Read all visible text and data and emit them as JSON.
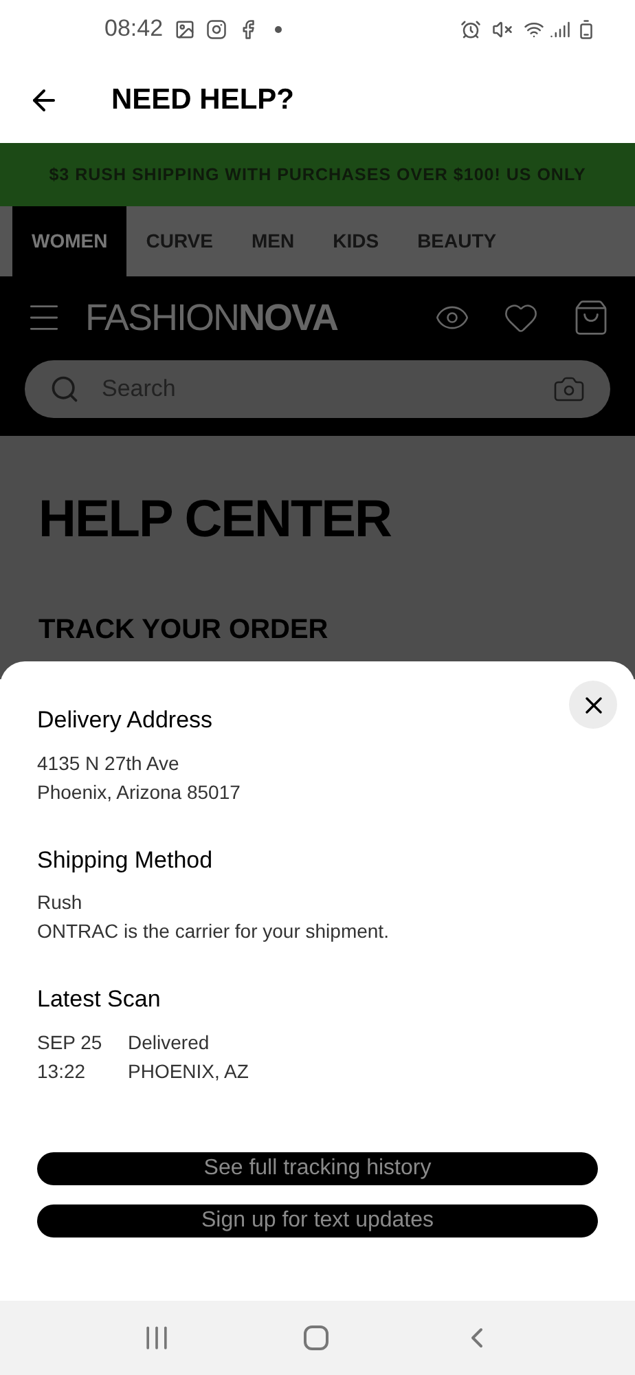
{
  "status_bar": {
    "time": "08:42"
  },
  "header": {
    "title": "NEED HELP?"
  },
  "banner": {
    "text": "$3 RUSH SHIPPING WITH PURCHASES OVER $100! US ONLY"
  },
  "tabs": [
    {
      "label": "WOMEN",
      "selected": true
    },
    {
      "label": "CURVE",
      "selected": false
    },
    {
      "label": "MEN",
      "selected": false
    },
    {
      "label": "KIDS",
      "selected": false
    },
    {
      "label": "BEAUTY",
      "selected": false
    }
  ],
  "logo": "FASHION**NOVA**",
  "search": {
    "placeholder": "Search"
  },
  "page": {
    "title": "HELP CENTER",
    "subtitle": "TRACK YOUR ORDER"
  },
  "sheet": {
    "sections": [
      {
        "heading": "Delivery Address",
        "lines": [
          "4135 N 27th Ave",
          "Phoenix, Arizona 85017"
        ]
      },
      {
        "heading": "Shipping Method",
        "lines": [
          "Rush",
          "ONTRAC is the carrier for your shipment."
        ]
      }
    ],
    "latest_scan": {
      "heading": "Latest Scan",
      "date": "SEP 25",
      "time": "13:22",
      "status": "Delivered",
      "location": "PHOENIX, AZ"
    },
    "buttons": [
      "See full tracking history",
      "Sign up for text updates"
    ]
  }
}
